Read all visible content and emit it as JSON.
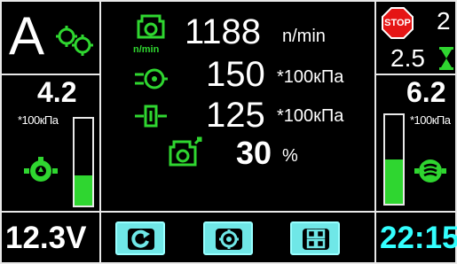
{
  "mode": {
    "letter": "A",
    "icon": "gears-icon"
  },
  "left_panel": {
    "value": "4.2",
    "unit": "*100кПа",
    "level": 0.35,
    "icon": "oil-pump-icon"
  },
  "right_panel": {
    "value": "6.2",
    "unit": "*100кПа",
    "level": 0.5,
    "icon": "transmission-pump-icon"
  },
  "center": {
    "rpm": {
      "value": "1188",
      "unit": "n/min",
      "icon_caption": "n/min",
      "icon": "engine-icon"
    },
    "pressure_1": {
      "value": "150",
      "unit": "*100кПа",
      "icon": "turbo-pressure-icon"
    },
    "pressure_2": {
      "value": "125",
      "unit": "*100кПа",
      "icon": "fuel-pressure-icon"
    },
    "load": {
      "value": "30",
      "unit": "%",
      "icon": "engine-load-icon"
    }
  },
  "top_right": {
    "stop_label": "STOP",
    "stop_count": "2",
    "hours_value": "2.5",
    "icon": "hourglass-icon"
  },
  "footer": {
    "voltage": "12.3V",
    "clock": "22:15",
    "buttons": [
      {
        "name": "refresh-button",
        "icon": "refresh-icon"
      },
      {
        "name": "settings-button",
        "icon": "gear-icon"
      },
      {
        "name": "menu-grid-button",
        "icon": "grid-icon"
      }
    ]
  },
  "colors": {
    "accent_green": "#2fd630",
    "button_cyan": "#6fe7e7",
    "clock_cyan": "#3ff",
    "stop_red": "#e51515"
  }
}
